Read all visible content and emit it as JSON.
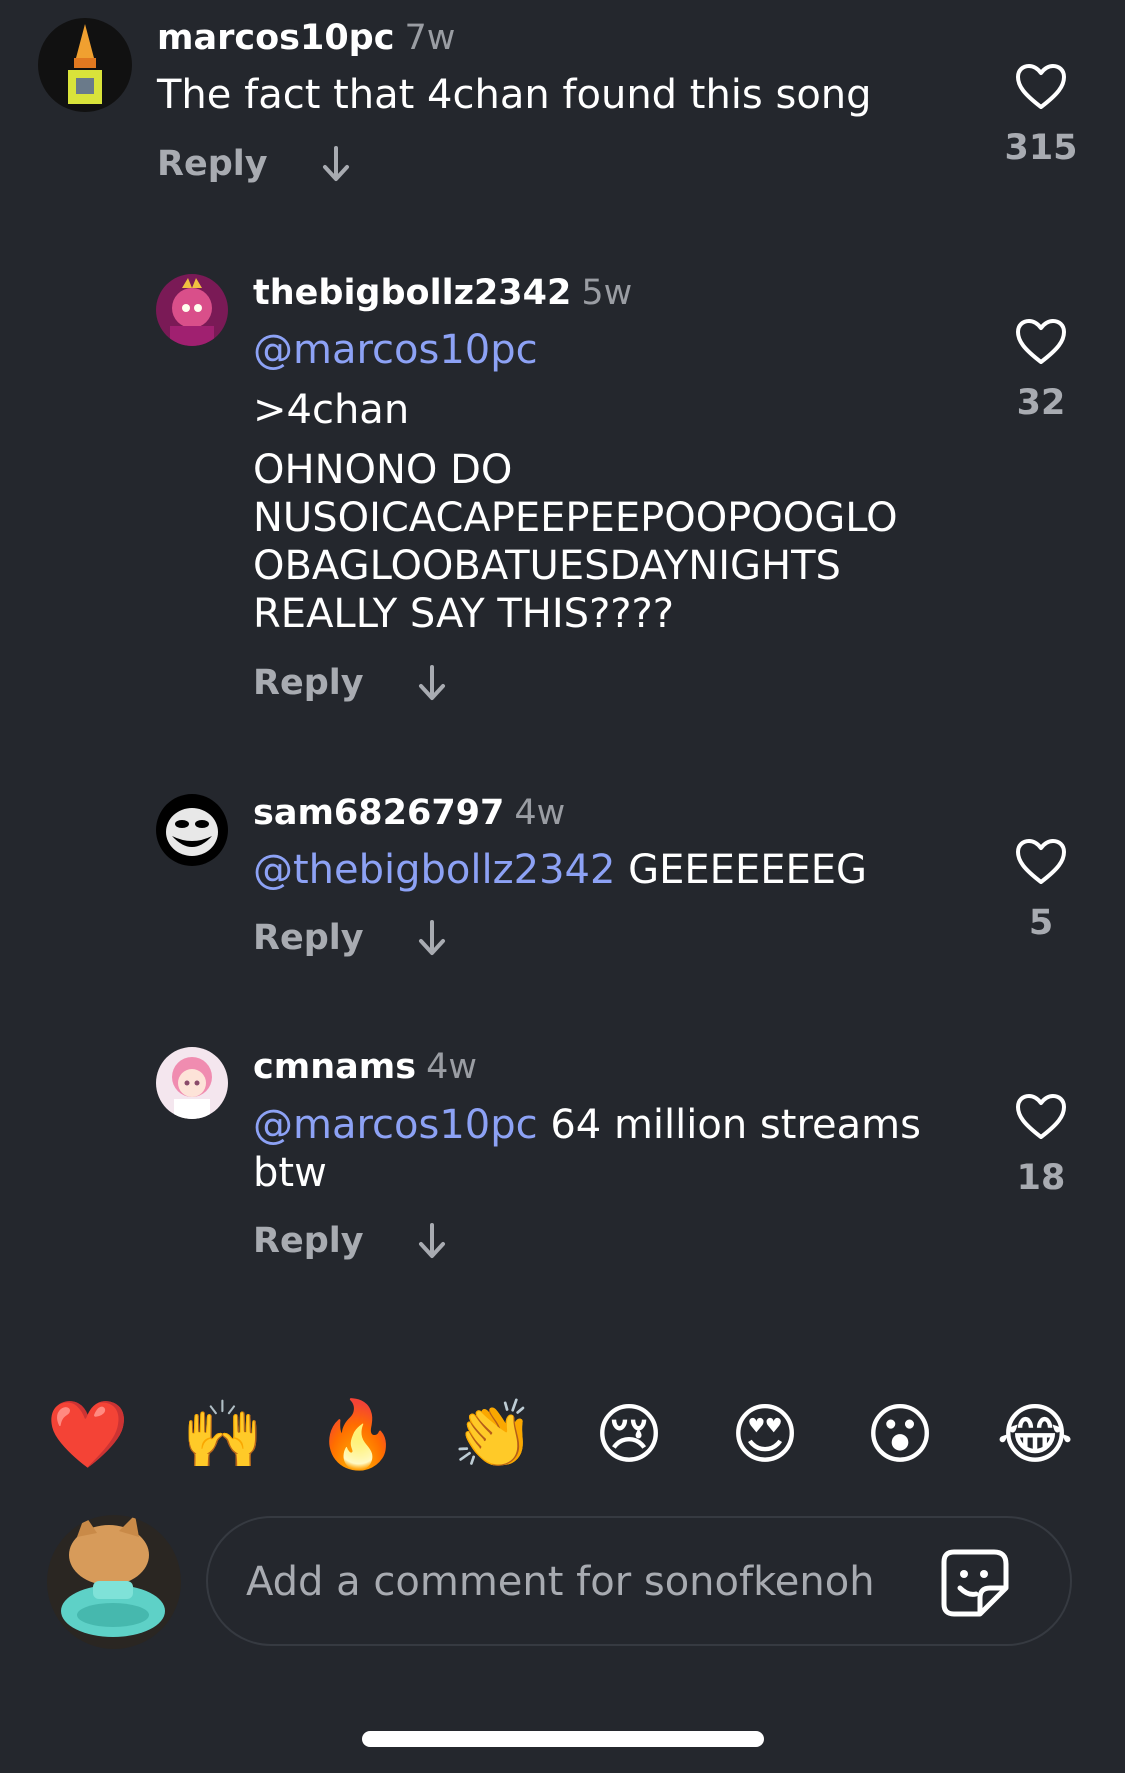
{
  "comments": [
    {
      "username": "marcos10pc",
      "time": "7w",
      "mention": "",
      "text": "The fact that 4chan found this song",
      "reply_label": "Reply",
      "likes": "315"
    },
    {
      "username": "thebigbollz2342",
      "time": "5w",
      "mention": "@marcos10pc",
      "line1": ">4chan",
      "text": "OHNONO DO NUSOICACAPEEPEEPOOPOOGLO OBAGLOOBATUESDAYNIGHTS REALLY SAY THIS????",
      "reply_label": "Reply",
      "likes": "32"
    },
    {
      "username": "sam6826797",
      "time": "4w",
      "mention": "@thebigbollz2342",
      "text": " GEEEEEEEG",
      "reply_label": "Reply",
      "likes": "5"
    },
    {
      "username": "cmnams",
      "time": "4w",
      "mention": "@marcos10pc",
      "text": " 64 million streams btw",
      "reply_label": "Reply",
      "likes": "18"
    }
  ],
  "emojis": [
    "❤️",
    "🙌",
    "🔥",
    "👏",
    "😢",
    "😍",
    "😮",
    "😂"
  ],
  "composer": {
    "placeholder": "Add a comment for sonofkenoh"
  },
  "colors": {
    "background": "#24272d",
    "mention": "#8da2f5",
    "muted": "#a8abb1"
  }
}
